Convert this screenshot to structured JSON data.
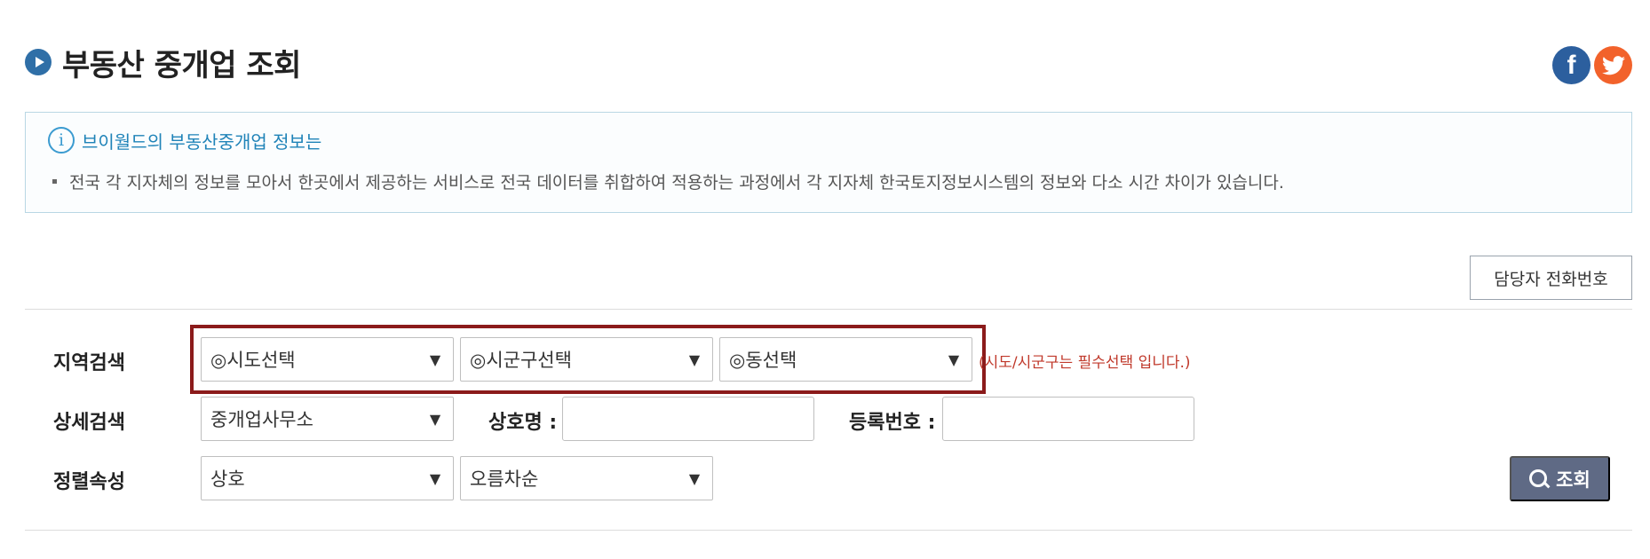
{
  "page": {
    "title": "부동산 중개업 조회"
  },
  "social": {
    "facebook_glyph": "f",
    "twitter_icon": "twitter-icon"
  },
  "info": {
    "title": "브이월드의 부동산중개업 정보는",
    "body": "전국 각 지자체의 정보를 모아서 한곳에서 제공하는 서비스로 전국 데이터를 취합하여 적용하는 과정에서 각 지자체 한국토지정보시스템의 정보와 다소 시간 차이가 있습니다."
  },
  "contact_button": "담당자 전화번호",
  "region_search": {
    "label": "지역검색",
    "sido": "◎시도선택",
    "sigungu": "◎시군구선택",
    "dong": "◎동선택",
    "required_note": "(시도/시군구는 필수선택 입니다.)"
  },
  "detail_search": {
    "label": "상세검색",
    "type": "중개업사무소",
    "name_label": "상호명 :",
    "name_value": "",
    "reg_label": "등록번호 :",
    "reg_value": ""
  },
  "sort": {
    "label": "정렬속성",
    "field": "상호",
    "order": "오름차순"
  },
  "search_button": "조회",
  "colors": {
    "highlight": "#8b1b1b",
    "info_title": "#1f83b8",
    "search_button": "#5f6a85",
    "required_note": "#c0392b"
  }
}
